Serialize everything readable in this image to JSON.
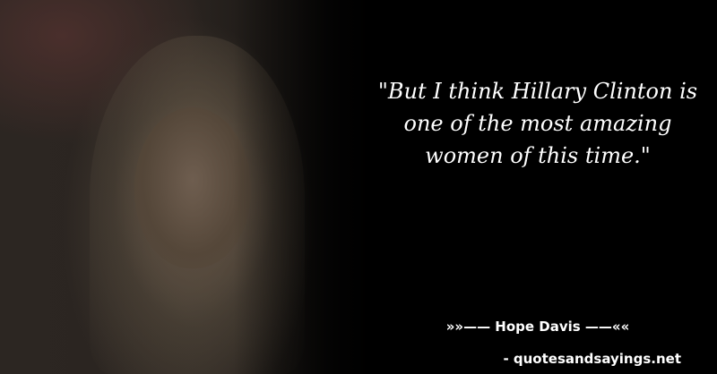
{
  "quote": {
    "text": "\"But I think Hillary Clinton is one of the most amazing women of this time.\""
  },
  "author": {
    "line": "»»—— Hope Davis ——««"
  },
  "source": {
    "line": "- quotesandsayings.net"
  },
  "colors": {
    "background": "#000000",
    "text": "#ffffff"
  }
}
